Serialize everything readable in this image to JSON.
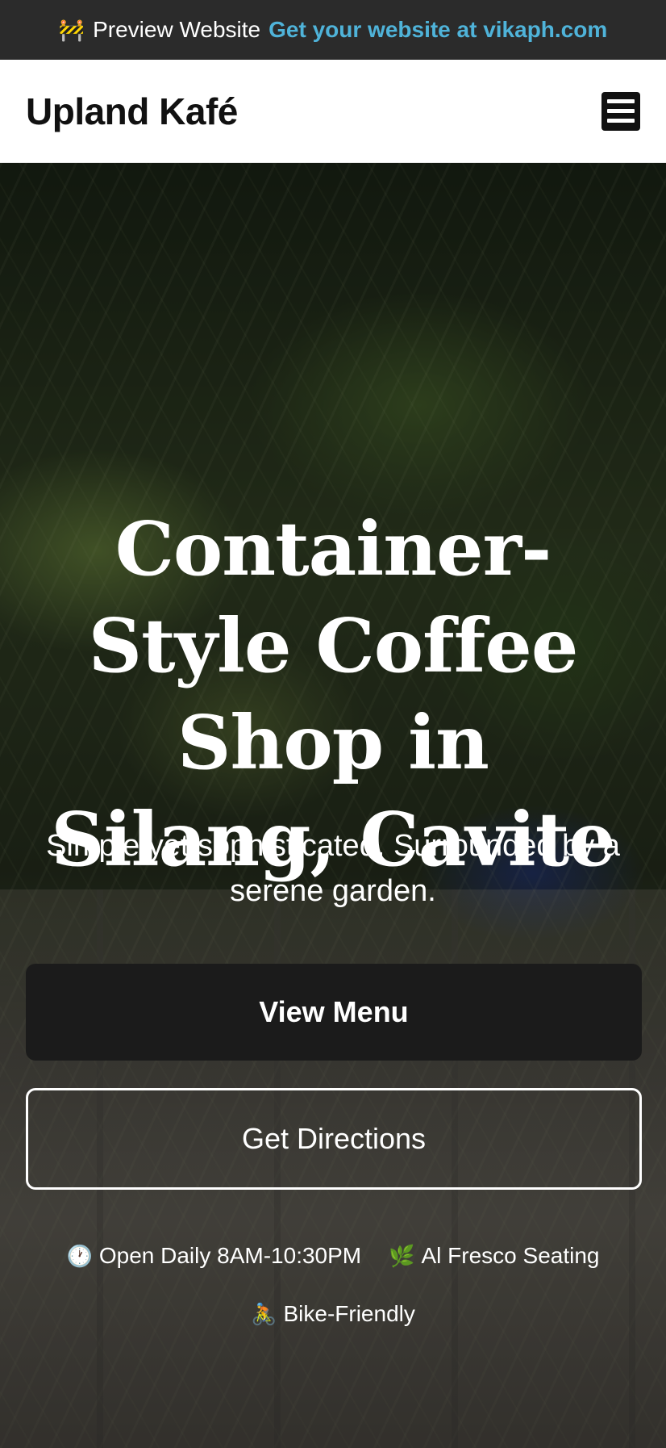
{
  "preview_bar": {
    "icon": "construction-icon",
    "label": "Preview Website",
    "cta": "Get your website at vikaph.com"
  },
  "header": {
    "brand": "Upland Kafé",
    "menu_icon": "hamburger-menu-icon"
  },
  "hero": {
    "title": "Container-Style Coffee Shop in Silang, Cavite",
    "subtitle": "Simple yet sophisticated. Surrounded by a serene garden.",
    "primary_button": "View Menu",
    "secondary_button": "Get Directions",
    "features": [
      {
        "icon": "clock-icon",
        "label": "Open Daily 8AM-10:30PM"
      },
      {
        "icon": "leaf-icon",
        "label": "Al Fresco Seating"
      },
      {
        "icon": "cyclist-icon",
        "label": "Bike-Friendly"
      }
    ]
  },
  "colors": {
    "accent": "#4fb3d9",
    "preview_bar_bg": "#2b2b2b",
    "primary_button_bg": "#1b1b1b"
  }
}
